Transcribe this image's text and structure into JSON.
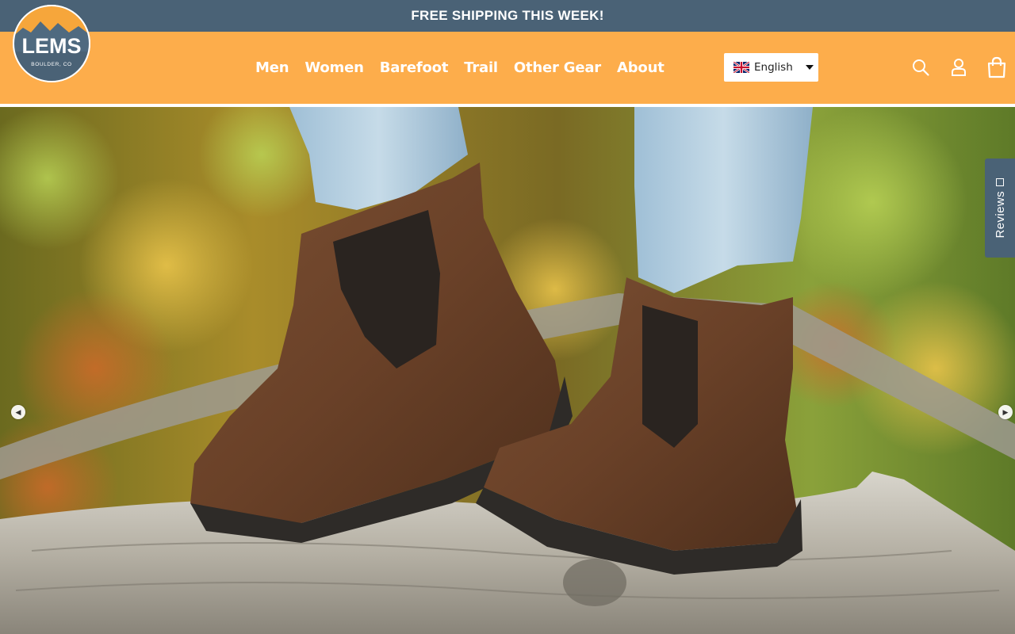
{
  "announcement": "FREE SHIPPING THIS WEEK!",
  "brand": {
    "logo_text": "LEMS",
    "logo_sub": "BOULDER, CO"
  },
  "nav": [
    {
      "label": "Men"
    },
    {
      "label": "Women"
    },
    {
      "label": "Barefoot"
    },
    {
      "label": "Trail"
    },
    {
      "label": "Other Gear"
    },
    {
      "label": "About"
    }
  ],
  "language": {
    "selected": "English",
    "flag_icon": "uk-flag-icon"
  },
  "header_icons": [
    "search-icon",
    "account-icon",
    "cart-icon"
  ],
  "reviews_tab": {
    "label": "Reviews"
  },
  "colors": {
    "announce_bg": "#4a6276",
    "header_bg": "#fdad4b",
    "accent": "#4a6276"
  }
}
